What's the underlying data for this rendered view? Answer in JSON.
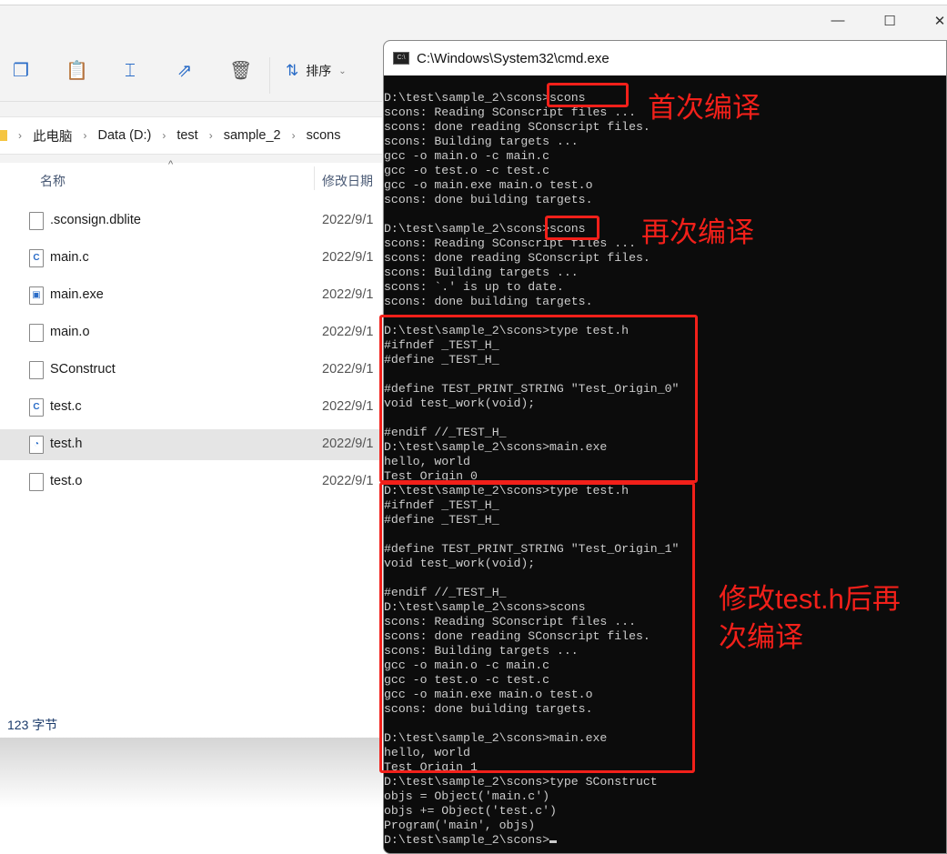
{
  "explorer": {
    "window_controls": [
      "—",
      "☐",
      "✕"
    ],
    "toolbar": {
      "icons": [
        "copy-icon",
        "paste-icon",
        "rename-icon",
        "share-icon",
        "delete-icon"
      ],
      "sort_label": "排序"
    },
    "breadcrumb": [
      "此电脑",
      "Data (D:)",
      "test",
      "sample_2",
      "scons"
    ],
    "columns": {
      "name": "名称",
      "modified": "修改日期"
    },
    "files": [
      {
        "name": ".sconsign.dblite",
        "date": "2022/9/1",
        "icon": "file"
      },
      {
        "name": "main.c",
        "date": "2022/9/1",
        "icon": "c"
      },
      {
        "name": "main.exe",
        "date": "2022/9/1",
        "icon": "exe"
      },
      {
        "name": "main.o",
        "date": "2022/9/1",
        "icon": "file"
      },
      {
        "name": "SConstruct",
        "date": "2022/9/1",
        "icon": "file"
      },
      {
        "name": "test.c",
        "date": "2022/9/1",
        "icon": "c"
      },
      {
        "name": "test.h",
        "date": "2022/9/1",
        "icon": "h",
        "selected": true
      },
      {
        "name": "test.o",
        "date": "2022/9/1",
        "icon": "file"
      }
    ],
    "status": "123 字节"
  },
  "cmd": {
    "title": "C:\\Windows\\System32\\cmd.exe",
    "output": "D:\\test\\sample_2\\scons>scons\nscons: Reading SConscript files ...\nscons: done reading SConscript files.\nscons: Building targets ...\ngcc -o main.o -c main.c\ngcc -o test.o -c test.c\ngcc -o main.exe main.o test.o\nscons: done building targets.\n\nD:\\test\\sample_2\\scons>scons\nscons: Reading SConscript files ...\nscons: done reading SConscript files.\nscons: Building targets ...\nscons: `.' is up to date.\nscons: done building targets.\n\nD:\\test\\sample_2\\scons>type test.h\n#ifndef _TEST_H_\n#define _TEST_H_\n\n#define TEST_PRINT_STRING \"Test_Origin_0\"\nvoid test_work(void);\n\n#endif //_TEST_H_\nD:\\test\\sample_2\\scons>main.exe\nhello, world\nTest Origin 0\nD:\\test\\sample_2\\scons>type test.h\n#ifndef _TEST_H_\n#define _TEST_H_\n\n#define TEST_PRINT_STRING \"Test_Origin_1\"\nvoid test_work(void);\n\n#endif //_TEST_H_\nD:\\test\\sample_2\\scons>scons\nscons: Reading SConscript files ...\nscons: done reading SConscript files.\nscons: Building targets ...\ngcc -o main.o -c main.c\ngcc -o test.o -c test.c\ngcc -o main.exe main.o test.o\nscons: done building targets.\n\nD:\\test\\sample_2\\scons>main.exe\nhello, world\nTest Origin 1\nD:\\test\\sample_2\\scons>type SConstruct\nobjs = Object('main.c')\nobjs += Object('test.c')\nProgram('main', objs)\nD:\\test\\sample_2\\scons>"
  },
  "annotations": {
    "first_build": "首次编译",
    "rebuild": "再次编译",
    "modified_rebuild_line1": "修改test.h后再",
    "modified_rebuild_line2": "次编译",
    "color": "#f2201a"
  }
}
